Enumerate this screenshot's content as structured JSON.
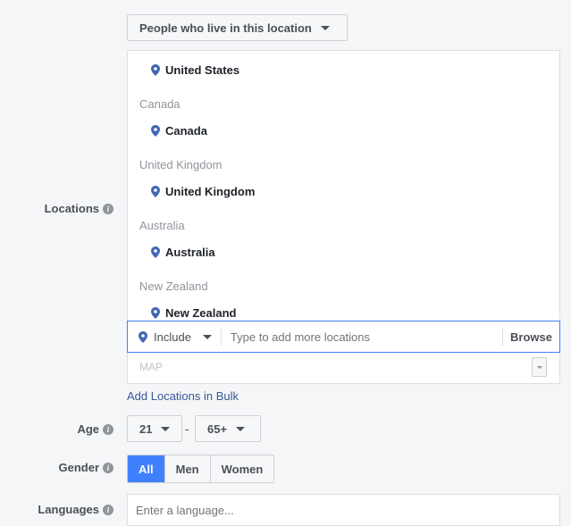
{
  "location_type": {
    "label": "People who live in this location"
  },
  "labels": {
    "locations": "Locations",
    "age": "Age",
    "gender": "Gender",
    "languages": "Languages"
  },
  "locations": [
    {
      "group": "",
      "name": "United States"
    },
    {
      "group": "Canada",
      "name": "Canada"
    },
    {
      "group": "United Kingdom",
      "name": "United Kingdom"
    },
    {
      "group": "Australia",
      "name": "Australia"
    },
    {
      "group": "New Zealand",
      "name": "New Zealand"
    }
  ],
  "include": {
    "label": "Include",
    "placeholder": "Type to add more locations",
    "browse": "Browse"
  },
  "map": {
    "label": "MAP"
  },
  "bulk_link": "Add Locations in Bulk",
  "age": {
    "min": "21",
    "separator": "-",
    "max": "65+"
  },
  "gender": {
    "options": [
      "All",
      "Men",
      "Women"
    ],
    "selected": "All"
  },
  "languages": {
    "placeholder": "Enter a language..."
  },
  "colors": {
    "accent": "#4080ff",
    "link": "#365899",
    "pin": "#4267b2"
  }
}
